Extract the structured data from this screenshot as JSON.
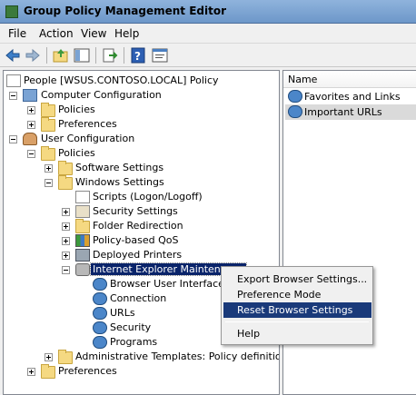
{
  "window": {
    "title": "Group Policy Management Editor"
  },
  "menubar": {
    "items": [
      "File",
      "Action",
      "View",
      "Help"
    ]
  },
  "toolbar": {
    "buttons": [
      "back-arrow-icon",
      "forward-arrow-icon",
      "up-folder-icon",
      "show-hide-tree-icon",
      "export-list-icon",
      "help-icon",
      "properties-icon"
    ]
  },
  "tree": {
    "root": "People [WSUS.CONTOSO.LOCAL] Policy",
    "computer_config": "Computer Configuration",
    "cc_policies": "Policies",
    "cc_preferences": "Preferences",
    "user_config": "User Configuration",
    "uc_policies": "Policies",
    "software_settings": "Software Settings",
    "windows_settings": "Windows Settings",
    "scripts": "Scripts (Logon/Logoff)",
    "security_settings": "Security Settings",
    "folder_redirection": "Folder Redirection",
    "policy_qos": "Policy-based QoS",
    "deployed_printers": "Deployed Printers",
    "ie_maintenance": "Internet Explorer Maintenance",
    "browser_ui": "Browser User Interface",
    "connection": "Connection",
    "urls": "URLs",
    "security": "Security",
    "programs": "Programs",
    "admin_templates": "Administrative Templates: Policy definitions (AI",
    "uc_preferences": "Preferences"
  },
  "list": {
    "column_name": "Name",
    "items": [
      "Favorites and Links",
      "Important URLs"
    ]
  },
  "context_menu": {
    "export": "Export Browser Settings...",
    "preference_mode": "Preference Mode",
    "reset": "Reset Browser Settings",
    "help": "Help"
  }
}
